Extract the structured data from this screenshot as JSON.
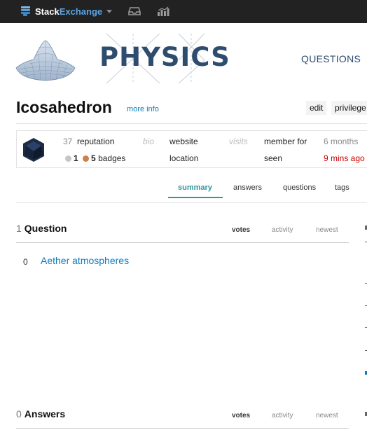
{
  "topbar": {
    "brand_stack": "Stack",
    "brand_exchange": "Exchange",
    "icons": [
      "stackexchange-icon",
      "inbox-icon",
      "achievements-icon"
    ]
  },
  "header": {
    "site_name": "PHYSICS",
    "nav_questions": "QUESTIONS"
  },
  "user": {
    "name": "Icosahedron",
    "more_info": "more info",
    "edit_label": "edit",
    "privileges_label": "privilege"
  },
  "card": {
    "reputation_value": "37",
    "reputation_label": "reputation",
    "badge_silver": "1",
    "badge_bronze": "5",
    "badges_label": "badges",
    "bio_label": "bio",
    "website_label": "website",
    "location_label": "location",
    "visits_label": "visits",
    "member_for_label": "member for",
    "seen_label": "seen",
    "member_for_value": "6 months",
    "seen_value": "9 mins ago"
  },
  "tabs": [
    {
      "label": "summary",
      "active": true
    },
    {
      "label": "answers",
      "active": false
    },
    {
      "label": "questions",
      "active": false
    },
    {
      "label": "tags",
      "active": false
    }
  ],
  "questions_section": {
    "count": "1",
    "title": "Question",
    "sort": [
      "votes",
      "activity",
      "newest"
    ],
    "items": [
      {
        "votes": "0",
        "title": "Aether atmospheres"
      }
    ]
  },
  "answers_section": {
    "count": "0",
    "title": "Answers",
    "sort": [
      "votes",
      "activity",
      "newest"
    ]
  },
  "colors": {
    "topbar": "#222222",
    "accent_link": "#0f7cbf",
    "tab_active": "#2a9a9f",
    "site_blue": "#2e4d6e",
    "seen_red": "#cc0000"
  }
}
